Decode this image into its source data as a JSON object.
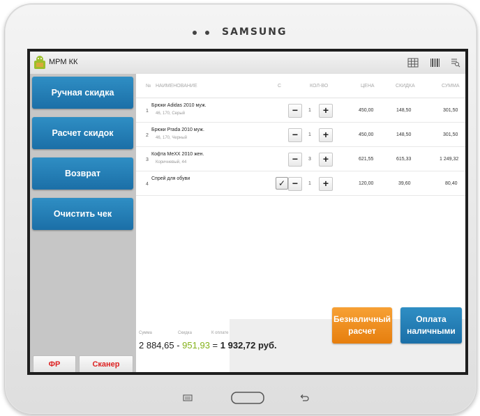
{
  "device": {
    "brand": "SAMSUNG"
  },
  "app": {
    "title": "МРМ КК"
  },
  "toolbar": {
    "icons": [
      "grid-icon",
      "barcode-icon",
      "receipt-search-icon"
    ]
  },
  "sidebar": {
    "buttons": [
      {
        "label": "Ручная скидка"
      },
      {
        "label": "Расчет скидок"
      },
      {
        "label": "Возврат"
      },
      {
        "label": "Очистить чек"
      }
    ],
    "bottom": {
      "fr": "ФР",
      "scanner": "Сканер"
    }
  },
  "table": {
    "headers": {
      "num": "№",
      "name": "НАИМЕНОВАНИЕ",
      "c": "С",
      "qty": "КОЛ-ВО",
      "price": "ЦЕНА",
      "discount": "СКИДКА",
      "sum": "СУММА"
    },
    "rows": [
      {
        "num": "1",
        "name": "Брюки Adidas 2010 муж.",
        "sub": "46, 170, Серый",
        "checked": false,
        "qty": "1",
        "price": "450,00",
        "discount": "148,50",
        "sum": "301,50"
      },
      {
        "num": "2",
        "name": "Брюки Prada 2010 муж.",
        "sub": "46, 170, Черный",
        "checked": false,
        "qty": "1",
        "price": "450,00",
        "discount": "148,50",
        "sum": "301,50"
      },
      {
        "num": "3",
        "name": "Кофта MeXX 2010 жен.",
        "sub": "Коричневый, 44",
        "checked": false,
        "qty": "3",
        "price": "621,55",
        "discount": "615,33",
        "sum": "1 249,32"
      },
      {
        "num": "4",
        "name": "Спрей для обуви",
        "sub": "",
        "checked": true,
        "qty": "1",
        "price": "120,00",
        "discount": "39,60",
        "sum": "80,40"
      }
    ],
    "minus": "−",
    "plus": "+",
    "check": "✓"
  },
  "footer": {
    "sum_label": "Сумма",
    "discount_label": "Скидка",
    "topay_label": "К оплате",
    "sum": "2 884,65",
    "minus": " - ",
    "discount": "951,93",
    "equals": " = ",
    "topay": "1 932,72 руб."
  },
  "pay": {
    "cashless_line1": "Безналичный",
    "cashless_line2": "расчет",
    "cash_line1": "Оплата",
    "cash_line2": "наличными"
  },
  "colors": {
    "accent_blue": "#1f77ad",
    "accent_orange": "#f08a1d",
    "discount_green": "#84b21a",
    "alert_red": "#dd2222"
  }
}
